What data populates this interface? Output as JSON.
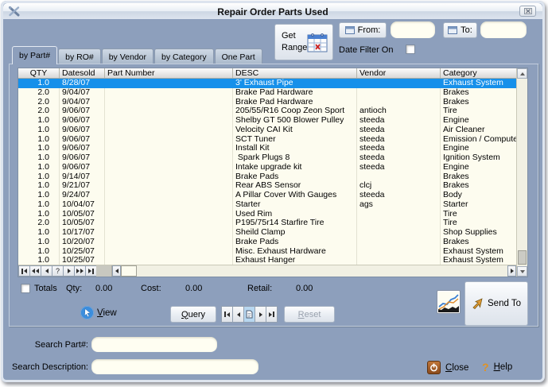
{
  "window": {
    "title": "Repair Order Parts Used"
  },
  "toolbar": {
    "get_range": "Get Range",
    "from_label": "From:",
    "from_value": "",
    "to_label": "To:",
    "to_value": "",
    "date_filter_label": "Date Filter On",
    "date_filter_checked": false
  },
  "tabs": [
    {
      "label": "by Part#",
      "active": true
    },
    {
      "label": "by RO#",
      "active": false
    },
    {
      "label": "by Vendor",
      "active": false
    },
    {
      "label": "by Category",
      "active": false
    },
    {
      "label": "One Part",
      "active": false
    }
  ],
  "grid": {
    "columns": [
      "QTY",
      "Datesold",
      "Part Number",
      "DESC",
      "Vendor",
      "Category"
    ],
    "selected_index": 0,
    "rows": [
      [
        "1.0",
        "8/28/07",
        "",
        "3' Exhaust Pipe",
        "",
        "Exhaust System"
      ],
      [
        "2.0",
        "9/04/07",
        "",
        "Brake Pad Hardware",
        "",
        "Brakes"
      ],
      [
        "2.0",
        "9/04/07",
        "",
        "Brake Pad Hardware",
        "",
        "Brakes"
      ],
      [
        "2.0",
        "9/06/07",
        "",
        "205/55/R16 Coop Zeon Sport",
        "antioch",
        "Tire"
      ],
      [
        "1.0",
        "9/06/07",
        "",
        "Shelby GT 500 Blower Pulley",
        "steeda",
        "Engine"
      ],
      [
        "1.0",
        "9/06/07",
        "",
        "Velocity CAI Kit",
        "steeda",
        "Air Cleaner"
      ],
      [
        "1.0",
        "9/06/07",
        "",
        "SCT Tuner",
        "steeda",
        "Emission / Compute"
      ],
      [
        "1.0",
        "9/06/07",
        "",
        "Install Kit",
        "steeda",
        "Engine"
      ],
      [
        "1.0",
        "9/06/07",
        "",
        " Spark Plugs 8",
        "steeda",
        "Ignition System"
      ],
      [
        "1.0",
        "9/06/07",
        "",
        "Intake upgrade kit",
        "steeda",
        "Engine"
      ],
      [
        "1.0",
        "9/14/07",
        "",
        "Brake Pads",
        "",
        "Brakes"
      ],
      [
        "1.0",
        "9/21/07",
        "",
        "Rear ABS Sensor",
        "clcj",
        "Brakes"
      ],
      [
        "1.0",
        "9/24/07",
        "",
        "A Pillar Cover With Gauges",
        "steeda",
        "Body"
      ],
      [
        "1.0",
        "10/04/07",
        "",
        "Starter",
        "ags",
        "Starter"
      ],
      [
        "1.0",
        "10/05/07",
        "",
        "Used Rim",
        "",
        "Tire"
      ],
      [
        "2.0",
        "10/05/07",
        "",
        "P195/75r14 Starfire Tire",
        "",
        "Tire"
      ],
      [
        "1.0",
        "10/17/07",
        "",
        "Sheild Clamp",
        "",
        "Shop Supplies"
      ],
      [
        "1.0",
        "10/20/07",
        "",
        "Brake Pads",
        "",
        "Brakes"
      ],
      [
        "1.0",
        "10/25/07",
        "",
        "Misc. Exhaust Hardware",
        "",
        "Exhaust System"
      ],
      [
        "1.0",
        "10/25/07",
        "",
        "Exhaust Hanger",
        "",
        "Exhaust System"
      ]
    ]
  },
  "totals": {
    "checkbox_label": "Totals",
    "checked": false,
    "qty_label": "Qty:",
    "qty_value": "0.00",
    "cost_label": "Cost:",
    "cost_value": "0.00",
    "retail_label": "Retail:",
    "retail_value": "0.00"
  },
  "actions": {
    "view": {
      "hotkey": "V",
      "rest": "iew"
    },
    "query": {
      "hotkey": "Q",
      "rest": "uery"
    },
    "reset": {
      "hotkey": "R",
      "rest": "eset",
      "disabled": true
    },
    "send_to": "Send To"
  },
  "search": {
    "part_label": "Search Part#:",
    "part_value": "",
    "desc_label": "Search Description:",
    "desc_value": ""
  },
  "footer": {
    "close": {
      "hotkey": "C",
      "rest": "lose"
    },
    "help": {
      "hotkey": "H",
      "rest": "elp"
    }
  },
  "colors": {
    "window_bg": "#8D9FBC",
    "selection_blue": "#1690EA",
    "grid_bg": "#FDFCEF",
    "input_bg": "#FFFEF2",
    "accent_orange": "#E09A33"
  }
}
